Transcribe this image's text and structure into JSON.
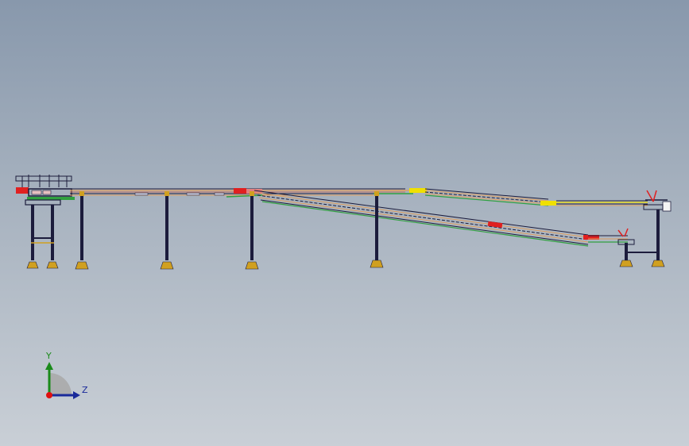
{
  "viewport": {
    "background_top": "#8898ac",
    "background_bottom": "#c9cfd6"
  },
  "model": {
    "description_colors": {
      "frame": "#1c1c3c",
      "rail_orange": "#e0a060",
      "rail_yellow": "#f0e000",
      "rail_green": "#30a040",
      "accent_red": "#e02020",
      "foot_gold": "#d0a020"
    }
  },
  "triad": {
    "y_label": "Y",
    "z_label": "Z",
    "y_color": "#1a8a1a",
    "z_color": "#1a2a9a",
    "origin_color": "#e01010",
    "wedge_color": "#a8a8a8"
  }
}
